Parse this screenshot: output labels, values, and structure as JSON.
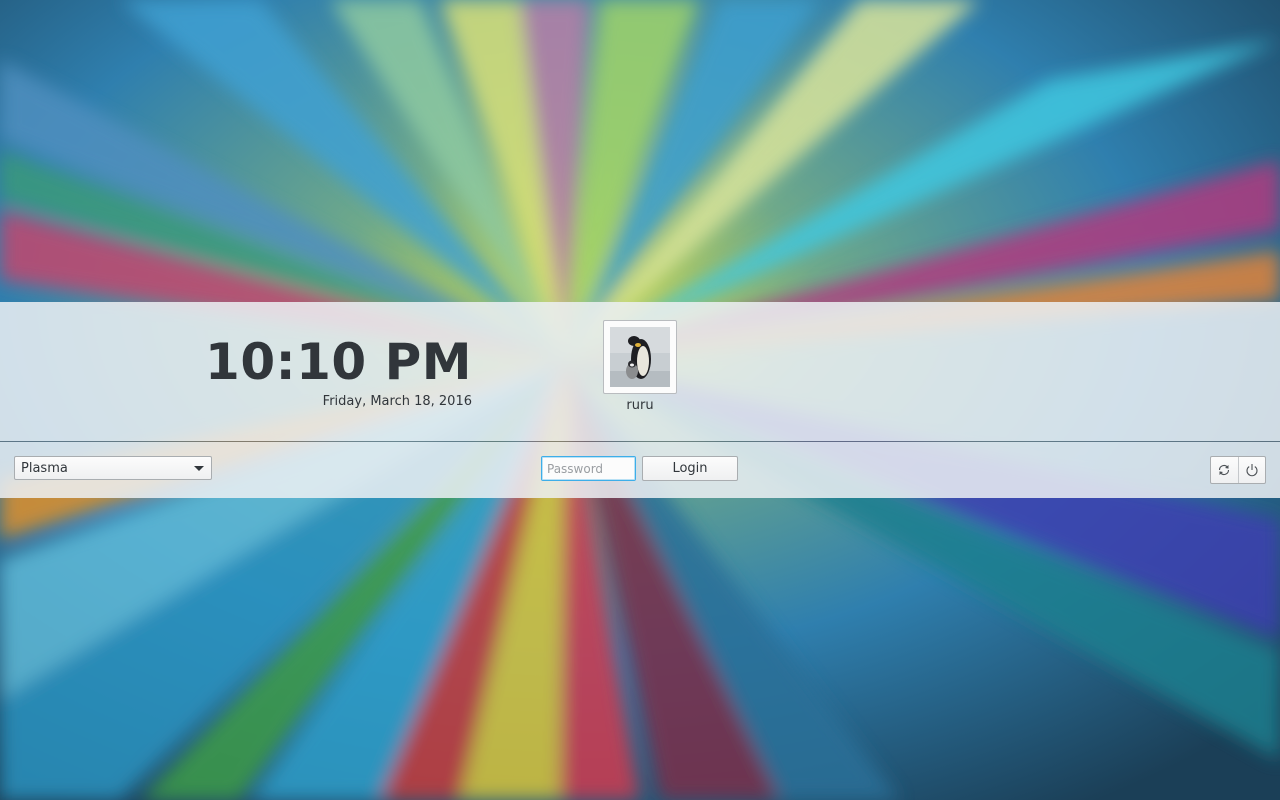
{
  "clock": {
    "time": "10:10 PM",
    "date": "Friday, March 18, 2016"
  },
  "user": {
    "name": "ruru",
    "avatar_icon": "penguin-avatar-icon"
  },
  "session": {
    "selected": "Plasma",
    "options": [
      "Plasma"
    ]
  },
  "login": {
    "password_placeholder": "Password",
    "password_value": "",
    "login_label": "Login"
  },
  "power": {
    "reboot_icon": "reboot-icon",
    "shutdown_icon": "shutdown-icon"
  },
  "colors": {
    "accent": "#3daee9",
    "text": "#31363b",
    "panel": "#eff0f1"
  }
}
